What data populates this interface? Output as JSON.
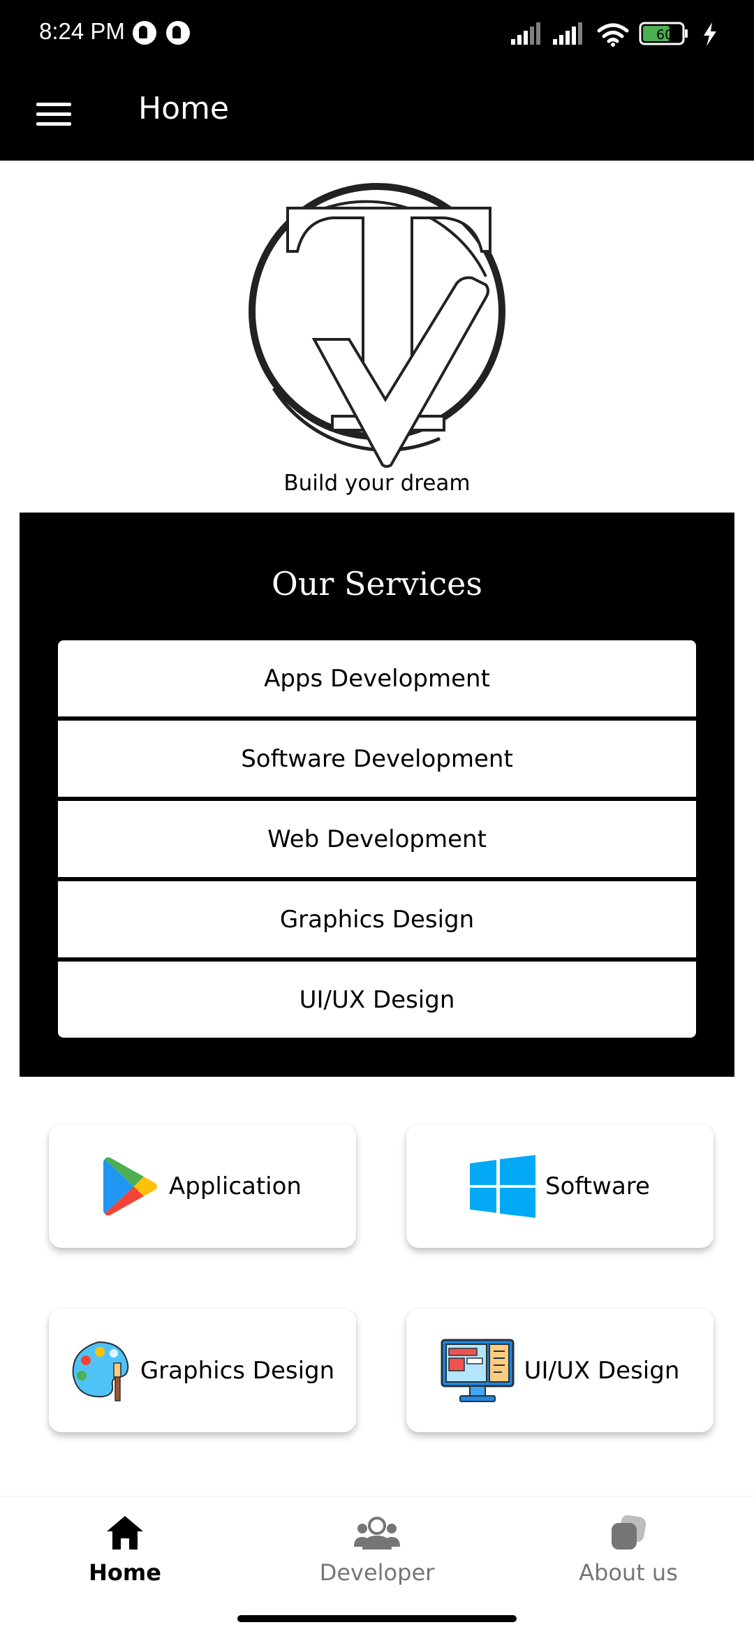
{
  "status_bar": {
    "time": "8:24 PM",
    "battery_level": "60",
    "icons": [
      "app-notification-icon",
      "app-notification-icon",
      "signal-icon",
      "signal-icon",
      "wifi-icon",
      "battery-icon",
      "charging-icon"
    ]
  },
  "app_bar": {
    "title": "Home",
    "menu_icon": "hamburger-menu-icon"
  },
  "header": {
    "tagline": "Build your dream"
  },
  "services": {
    "title": "Our Services",
    "items": [
      {
        "label": "Apps Development"
      },
      {
        "label": "Software Development"
      },
      {
        "label": "Web Development"
      },
      {
        "label": "Graphics Design"
      },
      {
        "label": "UI/UX Design"
      }
    ]
  },
  "cards": [
    {
      "label": "Application",
      "icon": "google-play-icon"
    },
    {
      "label": "Software",
      "icon": "windows-icon"
    },
    {
      "label": "Graphics Design",
      "icon": "palette-icon"
    },
    {
      "label": "UI/UX Design",
      "icon": "monitor-design-icon"
    }
  ],
  "bottom_nav": {
    "active": "Home",
    "items": [
      {
        "label": "Home",
        "icon": "home-icon"
      },
      {
        "label": "Developer",
        "icon": "group-icon"
      },
      {
        "label": "About us",
        "icon": "about-icon"
      }
    ]
  },
  "colors": {
    "bar_background": "#000000",
    "page_background": "#ffffff",
    "inactive_nav": "#757575",
    "battery_fill": "#4caf50",
    "windows_blue": "#03a9f4"
  }
}
